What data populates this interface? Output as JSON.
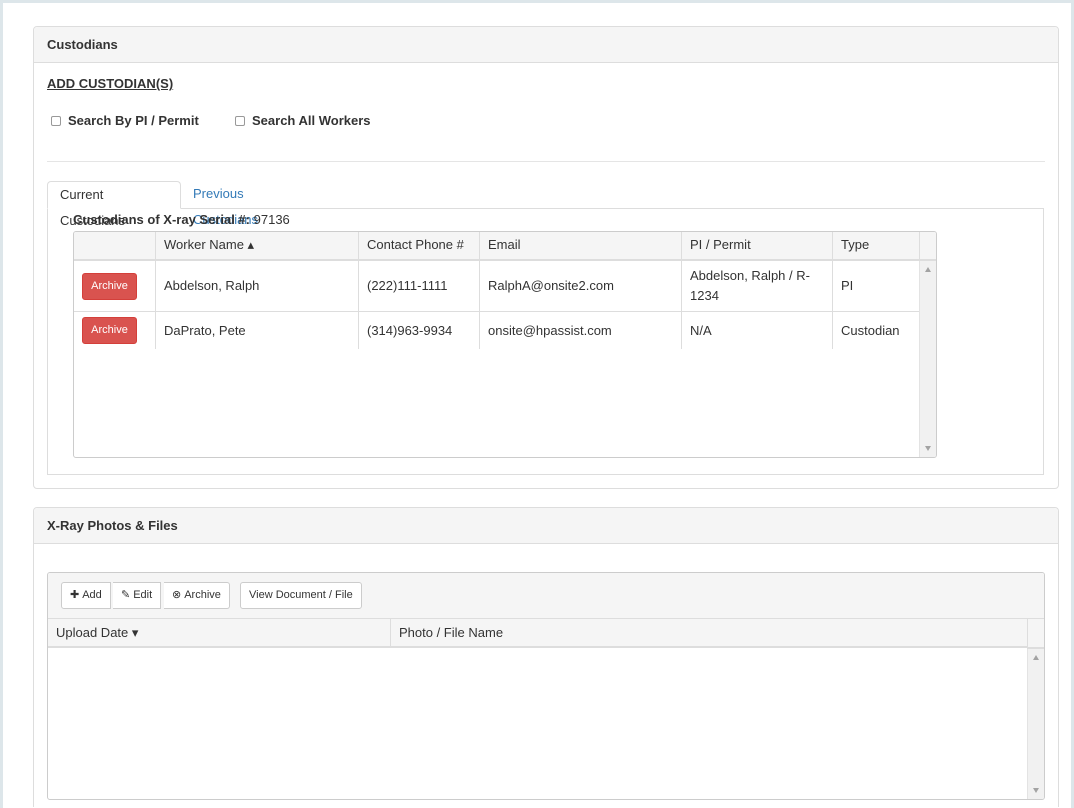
{
  "custodians_panel": {
    "title": "Custodians",
    "add_link": "ADD CUSTODIAN(S)",
    "checkbox_pi_permit": "Search By PI / Permit",
    "checkbox_all_workers": "Search All Workers",
    "tabs": [
      {
        "label": "Current Custodians",
        "active": true
      },
      {
        "label": "Previous Custodians",
        "active": false
      }
    ],
    "serial_label": "Custodians of X-ray Serial #:",
    "serial_value": "97136",
    "columns": [
      "",
      "Worker Name ▴",
      "Contact Phone #",
      "Email",
      "PI / Permit",
      "Type"
    ],
    "archive_label": "Archive",
    "rows": [
      {
        "worker": "Abdelson, Ralph",
        "phone": "(222)111-1111",
        "email": "RalphA@onsite2.com",
        "permit": "Abdelson, Ralph / R-1234",
        "type": "PI"
      },
      {
        "worker": "DaPrato, Pete",
        "phone": "(314)963-9934",
        "email": "onsite@hpassist.com",
        "permit": "N/A",
        "type": "Custodian"
      }
    ]
  },
  "files_panel": {
    "title": "X-Ray Photos & Files",
    "toolbar": {
      "add": "Add",
      "edit": "Edit",
      "archive": "Archive",
      "view": "View Document / File"
    },
    "columns": [
      "Upload Date ▾",
      "Photo / File Name"
    ]
  },
  "colors": {
    "archive_button": "#d9534f",
    "link": "#337ab7",
    "header_bg": "#f5f5f5",
    "frame_border": "#dde6ea"
  }
}
